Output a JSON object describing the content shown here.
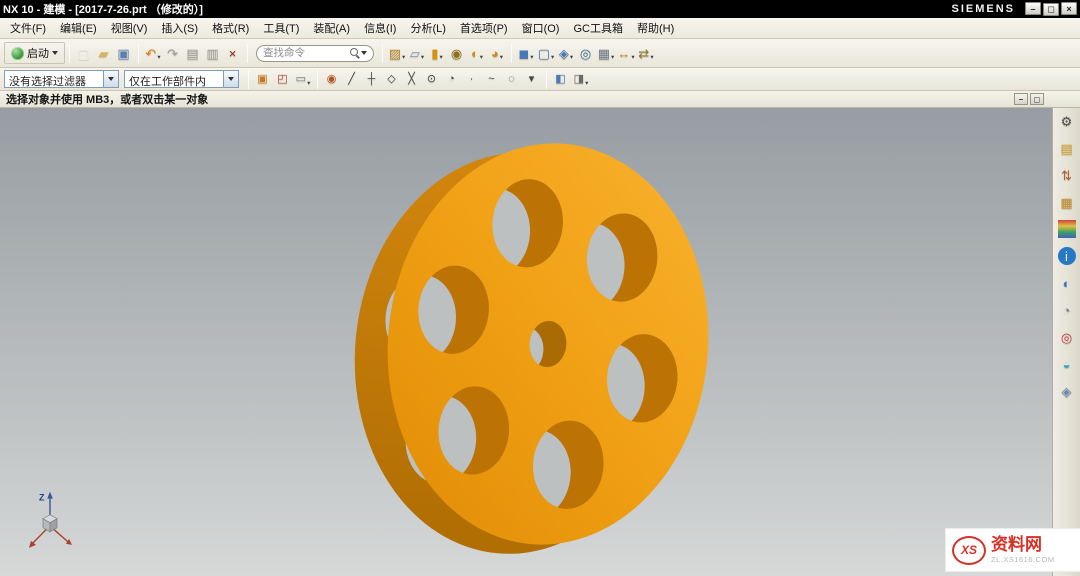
{
  "title_bar": {
    "title": "NX 10 - 建模 - [2017-7-26.prt （修改的）]",
    "brand": "SIEMENS",
    "window_buttons": [
      {
        "name": "minimize-button",
        "glyph": "–"
      },
      {
        "name": "restore-button",
        "glyph": "◻"
      },
      {
        "name": "close-button",
        "glyph": "×"
      }
    ]
  },
  "menu_bar": {
    "items": [
      {
        "label": "文件(F)"
      },
      {
        "label": "编辑(E)"
      },
      {
        "label": "视图(V)"
      },
      {
        "label": "插入(S)"
      },
      {
        "label": "格式(R)"
      },
      {
        "label": "工具(T)"
      },
      {
        "label": "装配(A)"
      },
      {
        "label": "信息(I)"
      },
      {
        "label": "分析(L)"
      },
      {
        "label": "首选项(P)"
      },
      {
        "label": "窗口(O)"
      },
      {
        "label": "GC工具箱"
      },
      {
        "label": "帮助(H)"
      }
    ]
  },
  "toolbar_main": {
    "start_label": "启动",
    "search_placeholder": "查找命令",
    "file_icons": [
      {
        "name": "new-file-icon",
        "glyph": "▢",
        "color": "#f2f2f2"
      },
      {
        "name": "open-file-icon",
        "glyph": "▰",
        "color": "#d9b35f"
      },
      {
        "name": "save-icon",
        "glyph": "▣",
        "color": "#5b7fb3"
      }
    ],
    "edit_icons": [
      {
        "name": "undo-icon",
        "glyph": "↶",
        "color": "#e07818",
        "caret": "▾"
      },
      {
        "name": "redo-icon",
        "glyph": "↷",
        "color": "#9a9a92"
      },
      {
        "name": "copy-icon",
        "glyph": "▤",
        "color": "#9a9a92"
      },
      {
        "name": "paste-icon",
        "glyph": "▥",
        "color": "#9a9a92"
      },
      {
        "name": "delete-icon",
        "glyph": "×",
        "color": "#8a2020"
      }
    ],
    "feature_icons": [
      {
        "name": "sketch-icon",
        "glyph": "▨",
        "color": "#b5862a",
        "caret": "▾"
      },
      {
        "name": "datum-plane-icon",
        "glyph": "▱",
        "color": "#7e93ad",
        "caret": "▾"
      },
      {
        "name": "extrude-icon",
        "glyph": "▮",
        "color": "#d79010",
        "caret": "▾"
      },
      {
        "name": "hole-icon",
        "glyph": "◉",
        "color": "#93701c"
      },
      {
        "name": "unite-icon",
        "glyph": "◐",
        "color": "#cf8c12",
        "caret": "▾"
      },
      {
        "name": "edge-blend-icon",
        "glyph": "◕",
        "color": "#c89020",
        "caret": "▾"
      }
    ],
    "view_icons": [
      {
        "name": "shaded-display-icon",
        "glyph": "◼",
        "color": "#4a7ab5",
        "caret": "▾"
      },
      {
        "name": "wireframe-display-icon",
        "glyph": "▢",
        "color": "#4a7ab5",
        "caret": "▾"
      },
      {
        "name": "orient-view-icon",
        "glyph": "◈",
        "color": "#4a7ab5",
        "caret": "▾"
      },
      {
        "name": "fit-view-icon",
        "glyph": "◎",
        "color": "#3f6e9e"
      },
      {
        "name": "pattern-icon",
        "glyph": "▦",
        "color": "#708090",
        "caret": "▾"
      },
      {
        "name": "measure-icon",
        "glyph": "↔",
        "color": "#b8860b",
        "caret": "▾"
      },
      {
        "name": "sync-modeling-icon",
        "glyph": "⇄",
        "color": "#8a7a30",
        "caret": "▾"
      }
    ]
  },
  "toolbar_selection": {
    "filter_value": "没有选择过滤器",
    "scope_value": "仅在工作部件内",
    "pre_icons": [
      {
        "name": "highlight-selection-icon",
        "glyph": "▣",
        "color": "#c87820"
      },
      {
        "name": "region-boundary-icon",
        "glyph": "◰",
        "color": "#b04040"
      },
      {
        "name": "lasso-icon",
        "glyph": "▭",
        "color": "#777777",
        "caret": "▾"
      }
    ],
    "snap_icons": [
      {
        "name": "snap-point-toggle-icon",
        "glyph": "◉",
        "color": "#b85020"
      },
      {
        "name": "endpoint-snap-icon",
        "glyph": "╱",
        "color": "#444444"
      },
      {
        "name": "midpoint-snap-icon",
        "glyph": "┼",
        "color": "#444444"
      },
      {
        "name": "control-point-snap-icon",
        "glyph": "◇",
        "color": "#444444"
      },
      {
        "name": "intersection-snap-icon",
        "glyph": "╳",
        "color": "#444444"
      },
      {
        "name": "arc-center-snap-icon",
        "glyph": "⊙",
        "color": "#444444"
      },
      {
        "name": "quadrant-snap-icon",
        "glyph": "◔",
        "color": "#444444"
      },
      {
        "name": "existing-point-snap-icon",
        "glyph": "∙",
        "color": "#444444"
      },
      {
        "name": "point-on-curve-snap-icon",
        "glyph": "~",
        "color": "#444444"
      },
      {
        "name": "point-on-face-snap-icon",
        "glyph": "◌",
        "color": "#444444"
      },
      {
        "name": "more-snap-options-icon",
        "glyph": "▾",
        "color": "#444444"
      }
    ],
    "post_icons": [
      {
        "name": "face-analysis-icon",
        "glyph": "◧",
        "color": "#4a7ab5"
      },
      {
        "name": "shadow-display-icon",
        "glyph": "◨",
        "color": "#6a6a6a",
        "caret": "▾"
      }
    ]
  },
  "prompt_bar": {
    "message": "选择对象并使用 MB3，或者双击某一对象",
    "buttons": [
      {
        "name": "child-minimize-button",
        "glyph": "–"
      },
      {
        "name": "child-restore-button",
        "glyph": "◻"
      }
    ]
  },
  "viewport": {
    "triad_label": "Z"
  },
  "resource_bar": {
    "icons": [
      {
        "name": "gear-icon",
        "glyph": "⚙",
        "color": "#4a4a4a"
      },
      {
        "name": "assembly-navigator-icon",
        "glyph": "▤",
        "color": "#d49a20"
      },
      {
        "name": "constraint-navigator-icon",
        "glyph": "⇅",
        "color": "#b06030"
      },
      {
        "name": "part-navigator-icon",
        "glyph": "▦",
        "color": "#c08a28"
      },
      {
        "name": "reuse-library-icon",
        "glyph": "",
        "bg": "linear-gradient(180deg,#d04040,#e0c040,#40a060,#4060c0)"
      },
      {
        "name": "hd3d-tools-icon",
        "glyph": "i",
        "color": "#ffffff",
        "bg": "#2878c8",
        "round": "50%"
      },
      {
        "name": "web-browser-icon",
        "glyph": "◐",
        "color": "#3878c0"
      },
      {
        "name": "history-icon",
        "glyph": "◔",
        "color": "#7a7a7a"
      },
      {
        "name": "process-studio-icon",
        "glyph": "◎",
        "color": "#c04040"
      },
      {
        "name": "roles-icon",
        "glyph": "◒",
        "color": "#3aa0c8"
      },
      {
        "name": "touch-mode-icon",
        "glyph": "◈",
        "color": "#6a8ab0"
      }
    ]
  },
  "watermark": {
    "logo_text": "XS",
    "site_name": "资料网",
    "site_url": "ZL.XS1616.COM"
  },
  "model": {
    "face_color": "#f0a016",
    "side_color": "#c67c06",
    "wall_color": "#bd7304",
    "center_wall_color": "#aa6b04",
    "bore_backdrop": "#bcc0c1"
  }
}
